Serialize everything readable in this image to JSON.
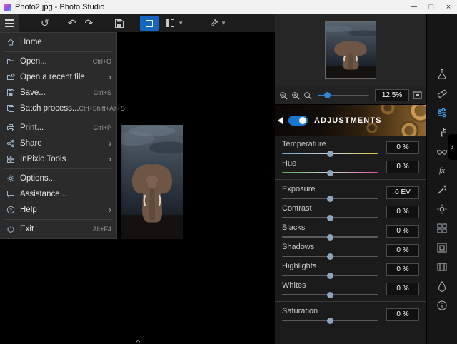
{
  "titlebar": {
    "title": "Photo2.jpg - Photo Studio"
  },
  "toolbar": {
    "icons": [
      "hamburger-menu",
      "rotate-reset",
      "undo",
      "redo",
      "save",
      "single-view",
      "split-view",
      "color-picker"
    ],
    "active_view": "single-view"
  },
  "menu": {
    "items": [
      {
        "label": "Home",
        "shortcut": "",
        "icon": "home-icon",
        "has_submenu": false
      },
      {
        "label": "Open...",
        "shortcut": "Ctrl+O",
        "icon": "open-folder-icon",
        "has_submenu": false
      },
      {
        "label": "Open a recent file",
        "shortcut": "",
        "icon": "recent-file-icon",
        "has_submenu": true
      },
      {
        "label": "Save...",
        "shortcut": "Ctrl+S",
        "icon": "save-floppy-icon",
        "has_submenu": false
      },
      {
        "label": "Batch process...",
        "shortcut": "Ctrl+Shift+Alt+S",
        "icon": "batch-stack-icon",
        "has_submenu": false
      },
      {
        "label": "Print...",
        "shortcut": "Ctrl+P",
        "icon": "printer-icon",
        "has_submenu": false
      },
      {
        "label": "Share",
        "shortcut": "",
        "icon": "share-icon",
        "has_submenu": true
      },
      {
        "label": "InPixio Tools",
        "shortcut": "",
        "icon": "tools-grid-icon",
        "has_submenu": true
      },
      {
        "label": "Options...",
        "shortcut": "",
        "icon": "gear-icon",
        "has_submenu": false
      },
      {
        "label": "Assistance...",
        "shortcut": "",
        "icon": "chat-bubble-icon",
        "has_submenu": false
      },
      {
        "label": "Help",
        "shortcut": "",
        "icon": "question-icon",
        "has_submenu": true
      },
      {
        "label": "Exit",
        "shortcut": "Alt+F4",
        "icon": "power-icon",
        "has_submenu": false
      }
    ]
  },
  "zoom": {
    "value": "12.5%"
  },
  "adjustments": {
    "title": "ADJUSTMENTS",
    "toggle_on": true,
    "sliders": [
      {
        "label": "Temperature",
        "value": "0 %",
        "position_pct": 50,
        "track": "temperature-gradient"
      },
      {
        "label": "Hue",
        "value": "0 %",
        "position_pct": 50,
        "track": "hue-gradient"
      },
      {
        "label": "Exposure",
        "value": "0 EV",
        "position_pct": 50,
        "track": "plain"
      },
      {
        "label": "Contrast",
        "value": "0 %",
        "position_pct": 50,
        "track": "plain"
      },
      {
        "label": "Blacks",
        "value": "0 %",
        "position_pct": 50,
        "track": "plain"
      },
      {
        "label": "Shadows",
        "value": "0 %",
        "position_pct": 50,
        "track": "plain"
      },
      {
        "label": "Highlights",
        "value": "0 %",
        "position_pct": 50,
        "track": "plain"
      },
      {
        "label": "Whites",
        "value": "0 %",
        "position_pct": 50,
        "track": "plain"
      },
      {
        "label": "Saturation",
        "value": "0 %",
        "position_pct": 50,
        "track": "plain"
      }
    ]
  },
  "right_toolbar": {
    "icons": [
      "flask-icon",
      "eraser-icon",
      "adjustments-sliders-icon",
      "roller-icon",
      "glasses-icon",
      "fx-icon",
      "wand-icon",
      "sun-icon",
      "grid-icon",
      "frame-icon",
      "film-icon",
      "drop-icon",
      "info-icon"
    ],
    "active": "adjustments-sliders-icon"
  },
  "colors": {
    "accent_blue": "#1876d2",
    "panel_bg": "#1b1b1b",
    "canvas_bg": "#000000"
  }
}
